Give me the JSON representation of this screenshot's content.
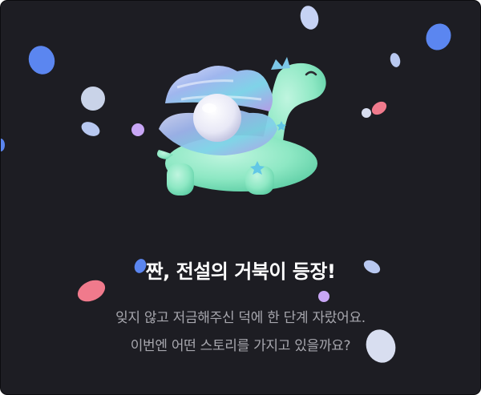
{
  "celebration": {
    "title": "짠, 전설의 거북이 등장!",
    "description_line1": "잊지 않고 저금해주신 덕에 한 단계 자랐어요.",
    "description_line2": "이번엔 어떤 스토리를 가지고 있을까요?"
  },
  "character": {
    "icon": "legendary-turtle-with-shell-icon",
    "colors": {
      "body": "#8ee8c4",
      "shell": "#b9c6f0",
      "pearl": "#eeeef8",
      "stars": "#62c7e6"
    }
  },
  "colors": {
    "background": "#1d1d23",
    "title": "#ffffff",
    "description": "#a7a7ae",
    "confetti": [
      "#5b86f0",
      "#b8c8f0",
      "#c8a6f5",
      "#f07a8c",
      "#ffffff"
    ]
  }
}
